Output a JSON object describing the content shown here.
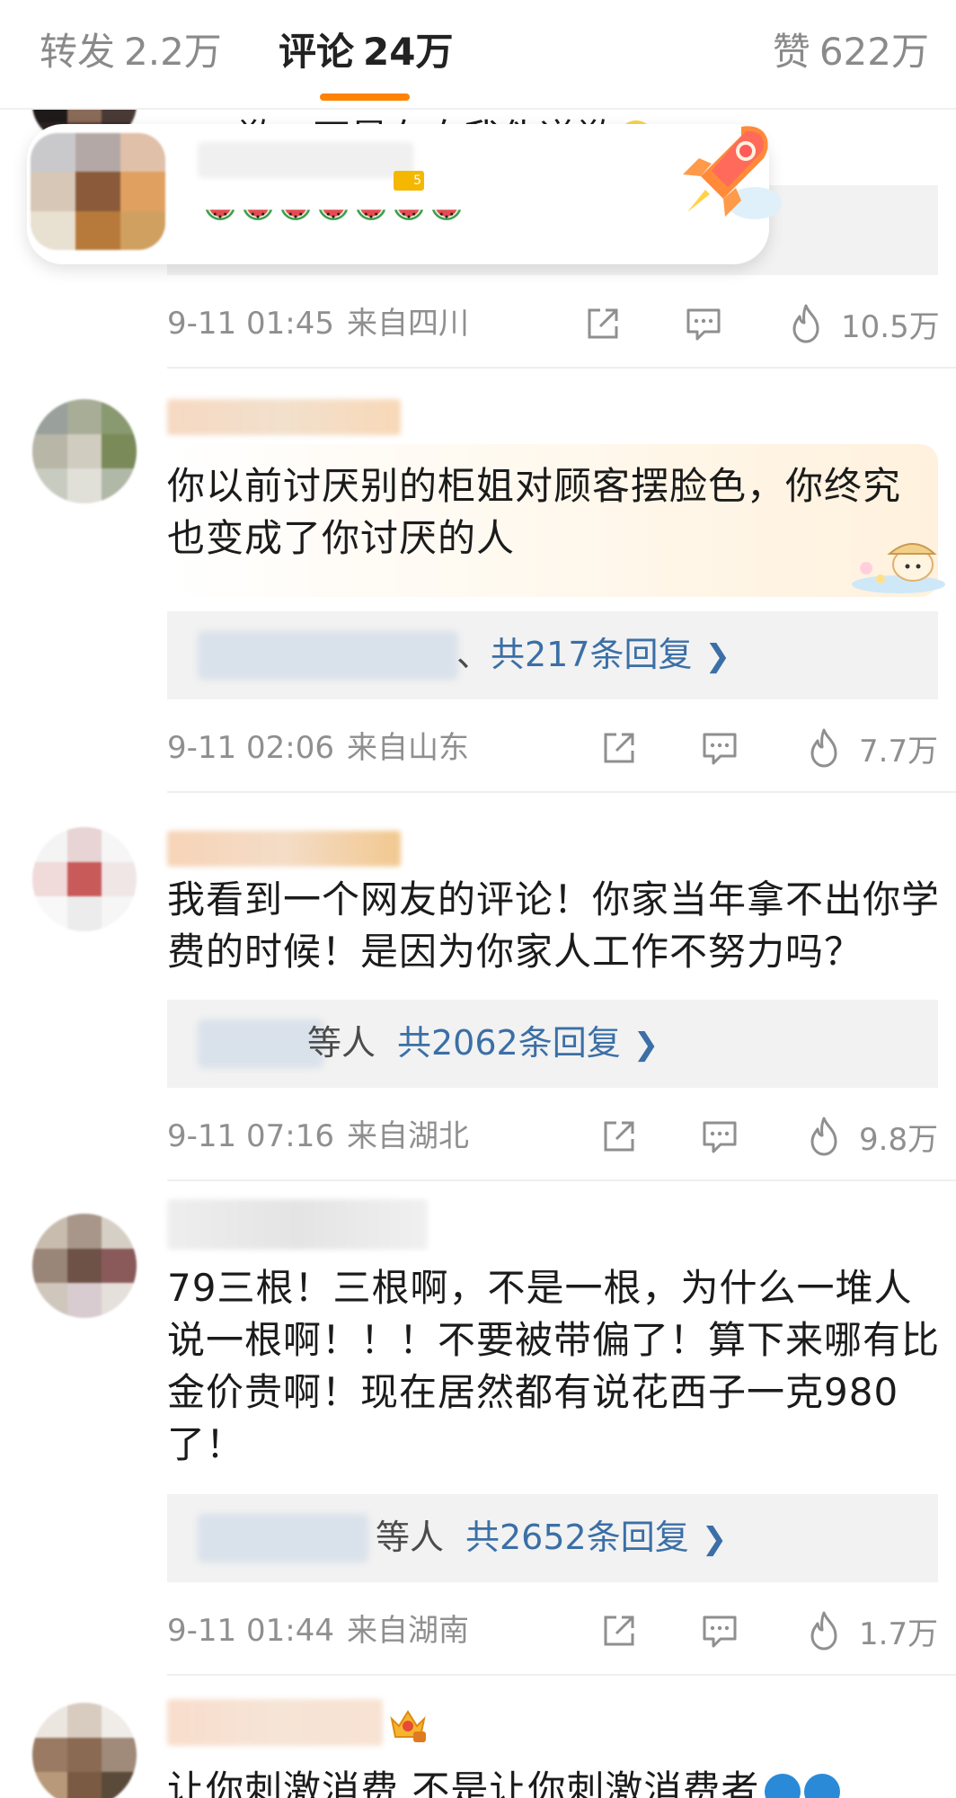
{
  "tabs": {
    "repost": {
      "label": "转发",
      "count": "2.2万"
    },
    "comments": {
      "label": "评论",
      "count": "24万"
    },
    "likes": {
      "label": "赞",
      "count": "622万"
    }
  },
  "comments": [
    {
      "text_visible": "歉，不是在自我伪道歉",
      "emojis": "🍉🍉🍉🍉🍉🍉🍉",
      "time": "9-11 01:45",
      "location": "来自四川",
      "likes": "10.5万"
    },
    {
      "text": "你以前讨厌别的柜姐对顾客摆脸色，你终究也变成了你讨厌的人",
      "reply_lead": "、",
      "reply_link": "共217条回复",
      "time": "9-11 02:06",
      "location": "来自山东",
      "likes": "7.7万"
    },
    {
      "text": "我看到一个网友的评论！你家当年拿不出你学费的时候！是因为你家人工作不努力吗？",
      "reply_lead": "等人",
      "reply_link": "共2062条回复",
      "time": "9-11 07:16",
      "location": "来自湖北",
      "likes": "9.8万"
    },
    {
      "text": "79三根！三根啊，不是一根，为什么一堆人说一根啊！！！不要被带偏了！算下来哪有比金价贵啊！现在居然都有说花西子一克980了！",
      "reply_lead": "等人",
      "reply_link": "共2652条回复",
      "time": "9-11 01:44",
      "location": "来自湖南",
      "likes": "1.7万"
    },
    {
      "text": "让你刺激消费 不是让你刺激消费者"
    }
  ],
  "colors": {
    "accent": "#ff8200",
    "link": "#3b6fa6",
    "meta": "#8f8f8f",
    "reply_bg": "#f2f2f2"
  },
  "icons": [
    "share-icon",
    "comment-icon",
    "like-flame-icon",
    "chevron-right-icon",
    "rocket-icon",
    "watermelon-icon",
    "crown-badge-icon"
  ]
}
